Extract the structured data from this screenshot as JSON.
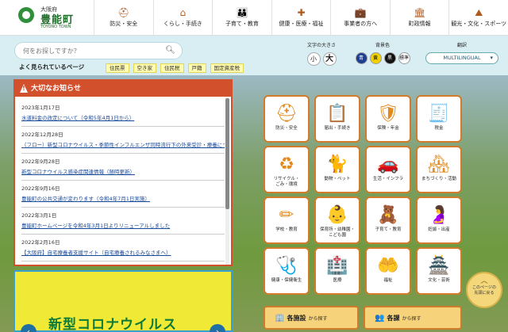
{
  "logo": {
    "prefecture": "大阪府",
    "town": "豊能町",
    "romaji": "TOYONO TOWN"
  },
  "nav": [
    {
      "icon": "helmet-icon",
      "glyph": "⛑",
      "label": "防災・安全"
    },
    {
      "icon": "house-icon",
      "glyph": "⌂",
      "label": "くらし・手続き"
    },
    {
      "icon": "family-icon",
      "glyph": "👪",
      "label": "子育て・教育"
    },
    {
      "icon": "health-icon",
      "glyph": "✚",
      "label": "健康・医療・福祉"
    },
    {
      "icon": "briefcase-icon",
      "glyph": "💼",
      "label": "事業者の方へ"
    },
    {
      "icon": "government-icon",
      "glyph": "🏛",
      "label": "町政情報"
    },
    {
      "icon": "tourism-icon",
      "glyph": "⛰",
      "label": "観光・文化・スポーツ"
    }
  ],
  "search": {
    "placeholder": "何をお探しですか？"
  },
  "popular": {
    "label": "よく見られているページ",
    "items": [
      "住民票",
      "空き家",
      "住民税",
      "戸籍",
      "国定資産税"
    ]
  },
  "font_size": {
    "label": "文字の大きさ",
    "small": "小",
    "large": "大"
  },
  "background": {
    "label": "背景色",
    "options": [
      "青",
      "黄",
      "黒",
      "標準"
    ],
    "colors": [
      "#1d3f8f",
      "#f2d100",
      "#111111",
      "#ffffff"
    ]
  },
  "translation": {
    "label": "翻訳",
    "button": "MULTILINGUAL"
  },
  "notice": {
    "title": "大切なお知らせ",
    "items": [
      {
        "date": "2023年1月17日",
        "title": "水道料金の改定について（令和5年4月1日から）"
      },
      {
        "date": "2022年12月28日",
        "title": "（フロー）新型コロナウイルス・季節性インフルエンザ同時流行下の外来受診・療養について"
      },
      {
        "date": "2022年9月28日",
        "title": "新型コロナウイルス感染症関連情報（随時更新）"
      },
      {
        "date": "2022年9月16日",
        "title": "豊能町の公共交通が変わります（令和4年7月1日実施）"
      },
      {
        "date": "2022年3月1日",
        "title": "豊能町ホームページを令和4年3月1日よりリニューアルしました"
      },
      {
        "date": "2022年2月16日",
        "title": "【大阪府】自宅療養者支援サイト（自宅療養されるみなさまへ）"
      }
    ]
  },
  "banner": {
    "title": "新型コロナウイルス",
    "prev": "‹",
    "next": "›"
  },
  "tiles": [
    {
      "icon": "helmet-icon",
      "glyph": "⛑",
      "label": "防災・安全"
    },
    {
      "icon": "document-icon",
      "glyph": "📋",
      "label": "届出・手続き"
    },
    {
      "icon": "insurance-icon",
      "glyph": "🛡",
      "label": "保険・年金"
    },
    {
      "icon": "tax-icon",
      "glyph": "🧾",
      "label": "税金"
    },
    {
      "icon": "recycle-icon",
      "glyph": "♻",
      "label": "リサイクル・\nごみ・環境"
    },
    {
      "icon": "pet-icon",
      "glyph": "🐈",
      "label": "動物・ペット"
    },
    {
      "icon": "car-icon",
      "glyph": "🚗",
      "label": "生活・インフラ"
    },
    {
      "icon": "town-icon",
      "glyph": "🏘",
      "label": "まちづくり・活動"
    },
    {
      "icon": "school-icon",
      "glyph": "✏",
      "label": "学校・教育"
    },
    {
      "icon": "nursery-icon",
      "glyph": "👶",
      "label": "保育所・幼稚園・\nこども園"
    },
    {
      "icon": "childcare-icon",
      "glyph": "🧸",
      "label": "子育て・教育"
    },
    {
      "icon": "pregnancy-icon",
      "glyph": "🤰",
      "label": "妊娠・出産"
    },
    {
      "icon": "stethoscope-icon",
      "glyph": "🩺",
      "label": "健康・保健衛生"
    },
    {
      "icon": "medical-icon",
      "glyph": "🏥",
      "label": "医療"
    },
    {
      "icon": "welfare-icon",
      "glyph": "🤲",
      "label": "福祉"
    },
    {
      "icon": "culture-icon",
      "glyph": "🏯",
      "label": "文化・芸術"
    }
  ],
  "bottom_buttons": [
    {
      "icon": "building-icon",
      "glyph": "🏢",
      "label": "各施設",
      "suffix": "から探す"
    },
    {
      "icon": "department-icon",
      "glyph": "👥",
      "label": "各課",
      "suffix": "から探す"
    }
  ],
  "back_to_top": {
    "arrow": "︿",
    "label": "このページの\n先頭に戻る"
  }
}
